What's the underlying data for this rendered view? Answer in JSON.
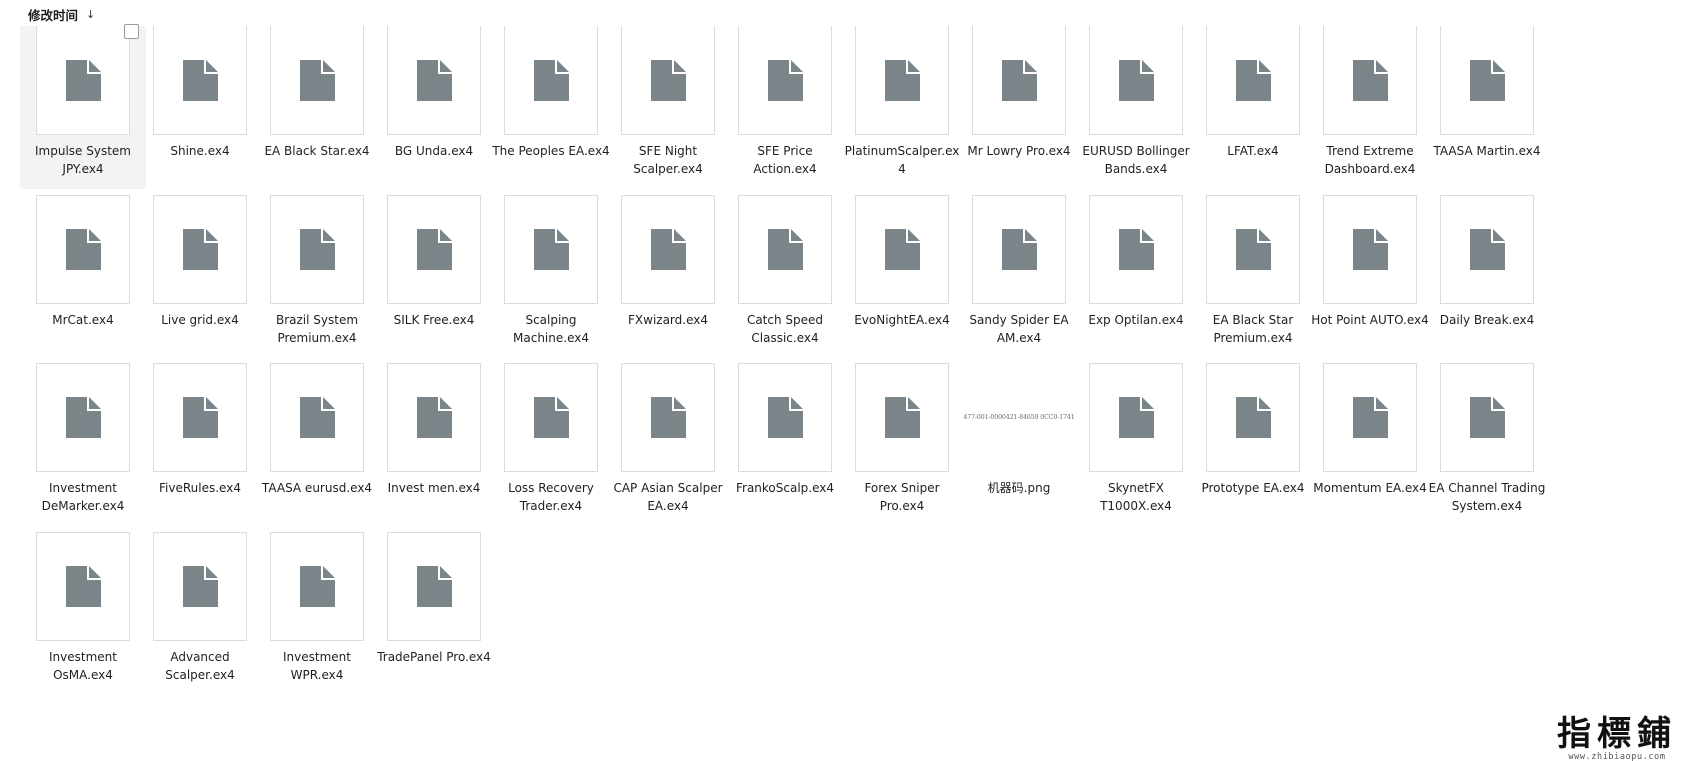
{
  "header": {
    "sort_label": "修改时间",
    "sort_arrow": "↓"
  },
  "icons": {
    "file": "generic-file-icon",
    "checkbox": "selection-checkbox"
  },
  "colors": {
    "file_icon": "#7b8589",
    "selected_bg": "#f3f3f3"
  },
  "files": [
    {
      "name": "Impulse System JPY.ex4",
      "selected": true
    },
    {
      "name": "Shine.ex4"
    },
    {
      "name": "EA Black Star.ex4"
    },
    {
      "name": "BG Unda.ex4"
    },
    {
      "name": "The Peoples EA.ex4"
    },
    {
      "name": "SFE Night Scalper.ex4"
    },
    {
      "name": "SFE Price Action.ex4"
    },
    {
      "name": "PlatinumScalper.ex4"
    },
    {
      "name": "Mr Lowry Pro.ex4"
    },
    {
      "name": "EURUSD Bollinger Bands.ex4"
    },
    {
      "name": "LFAT.ex4"
    },
    {
      "name": "Trend Extreme Dashboard.ex4"
    },
    {
      "name": "TAASA Martin.ex4"
    },
    {
      "name": "MrCat.ex4"
    },
    {
      "name": "Live grid.ex4"
    },
    {
      "name": "Brazil System Premium.ex4"
    },
    {
      "name": "SILK Free.ex4"
    },
    {
      "name": "Scalping Machine.ex4"
    },
    {
      "name": "FXwizard.ex4"
    },
    {
      "name": "Catch Speed Classic.ex4"
    },
    {
      "name": "EvoNightEA.ex4"
    },
    {
      "name": "Sandy Spider EA AM.ex4"
    },
    {
      "name": "Exp Optilan.ex4"
    },
    {
      "name": "EA Black Star Premium.ex4"
    },
    {
      "name": "Hot Point AUTO.ex4"
    },
    {
      "name": "Daily Break.ex4"
    },
    {
      "name": "Investment DeMarker.ex4"
    },
    {
      "name": "FiveRules.ex4"
    },
    {
      "name": "TAASA eurusd.ex4"
    },
    {
      "name": "Invest men.ex4"
    },
    {
      "name": "Loss Recovery Trader.ex4"
    },
    {
      "name": "CAP Asian Scalper EA.ex4"
    },
    {
      "name": "FrankoScalp.ex4"
    },
    {
      "name": "Forex Sniper Pro.ex4"
    },
    {
      "name": "机器码.png",
      "type": "image",
      "preview_text": "477-001-0000421-84659    0CC0-1741"
    },
    {
      "name": "SkynetFX T1000X.ex4"
    },
    {
      "name": "Prototype EA.ex4"
    },
    {
      "name": "Momentum EA.ex4"
    },
    {
      "name": "EA Channel Trading System.ex4"
    },
    {
      "name": "Investment OsMA.ex4"
    },
    {
      "name": "Advanced Scalper.ex4"
    },
    {
      "name": "Investment WPR.ex4"
    },
    {
      "name": "TradePanel Pro.ex4"
    }
  ],
  "watermark": {
    "main": "指標鋪",
    "sub": "www.zhibiaopu.com"
  }
}
